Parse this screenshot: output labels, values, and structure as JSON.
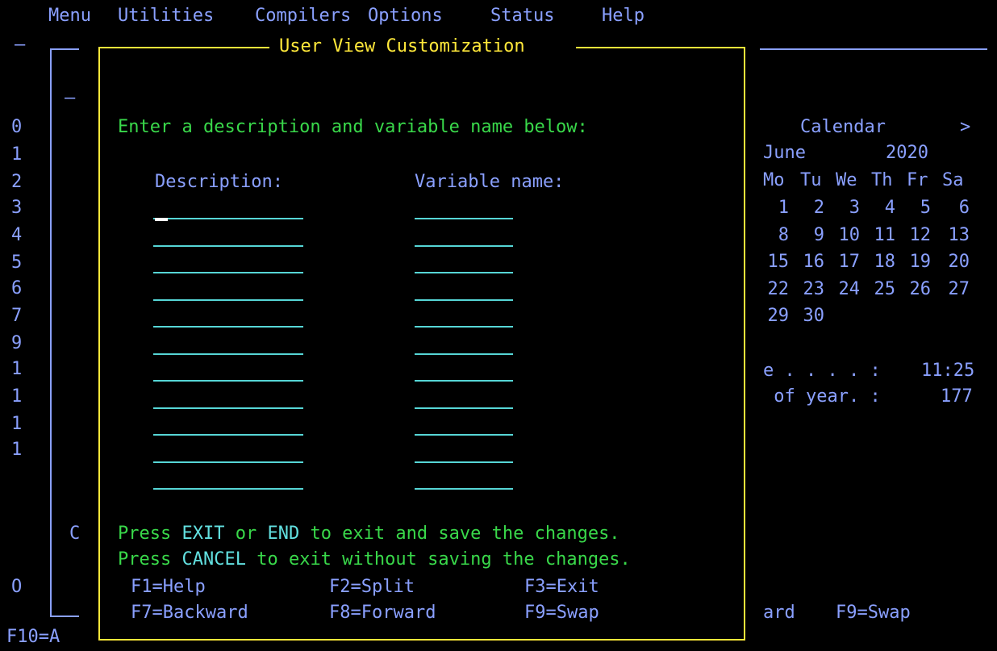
{
  "menubar": {
    "items": [
      "Menu",
      "Utilities",
      "Compilers",
      "Options",
      "Status",
      "Help"
    ]
  },
  "background": {
    "row_numbers": [
      "0",
      "1",
      "2",
      "3",
      "4",
      "5",
      "6",
      "7",
      "9",
      "1",
      "1",
      "1",
      "1"
    ],
    "left_c": "C",
    "left_o": "O",
    "bottom_left": "F10=A",
    "bottom_right_a": "ard",
    "bottom_right_b": "F9=Swap",
    "dash_top": "—",
    "dash_inner": "—"
  },
  "calendar": {
    "title": "Calendar",
    "next_arrow": ">",
    "month": "June",
    "year": "2020",
    "day_headers": [
      "Mo",
      "Tu",
      "We",
      "Th",
      "Fr",
      "Sa"
    ],
    "weeks": [
      [
        "1",
        "2",
        "3",
        "4",
        "5",
        "6"
      ],
      [
        "8",
        "9",
        "10",
        "11",
        "12",
        "13"
      ],
      [
        "15",
        "16",
        "17",
        "18",
        "19",
        "20"
      ],
      [
        "22",
        "23",
        "24",
        "25",
        "26",
        "27"
      ],
      [
        "29",
        "30",
        "",
        "",
        "",
        ""
      ]
    ],
    "time_label": "e . . . . :",
    "time_value": "11:25",
    "dayofyear_label": " of year. :",
    "dayofyear_value": "177"
  },
  "dialog": {
    "title": "User View Customization",
    "prompt": "Enter a description and variable name below:",
    "description_header": "Description:",
    "variable_header": "Variable name:",
    "row_count": 11,
    "exit_line": {
      "p1": "Press ",
      "k1": "EXIT",
      "p2": " or ",
      "k2": "END",
      "p3": " to exit and save the changes."
    },
    "cancel_line": {
      "p1": "Press ",
      "k1": "CANCEL",
      "p2": " to exit without saving the changes."
    },
    "fkeys": {
      "f1": "F1=Help",
      "f2": "F2=Split",
      "f3": "F3=Exit",
      "f7": "F7=Backward",
      "f8": "F8=Forward",
      "f9": "F9=Swap"
    }
  },
  "colors": {
    "blue": "#8aa0ff",
    "green": "#39d84a",
    "yellow": "#ffe83a",
    "cyan": "#62e0e0"
  }
}
